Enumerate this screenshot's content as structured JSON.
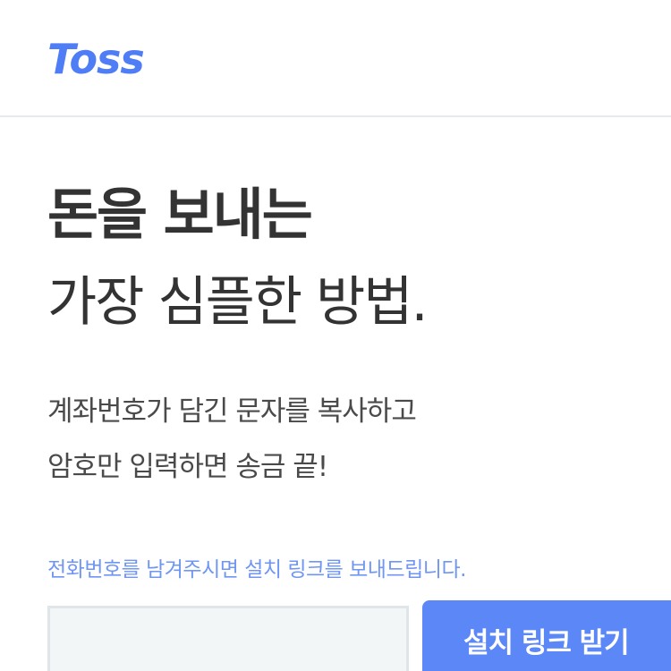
{
  "header": {
    "logo_text": "Toss"
  },
  "hero": {
    "headline_line1": "돈을 보내는",
    "headline_line2": "가장 심플한 방법.",
    "description_line1": "계좌번호가 담긴 문자를 복사하고",
    "description_line2": "암호만 입력하면 송금 끝!"
  },
  "signup": {
    "notice": "전화번호를 남겨주시면 설치 링크를 보내드립니다.",
    "phone_value": "",
    "phone_placeholder": "",
    "button_label": "설치 링크 받기"
  },
  "colors": {
    "brand": "#4f7df5",
    "headline": "#333333",
    "body_text": "#4a4a4a",
    "notice": "#6f96f3",
    "button_bg": "#5b87f7",
    "input_bg": "#f3f6f7",
    "divider": "#e8ebee"
  }
}
